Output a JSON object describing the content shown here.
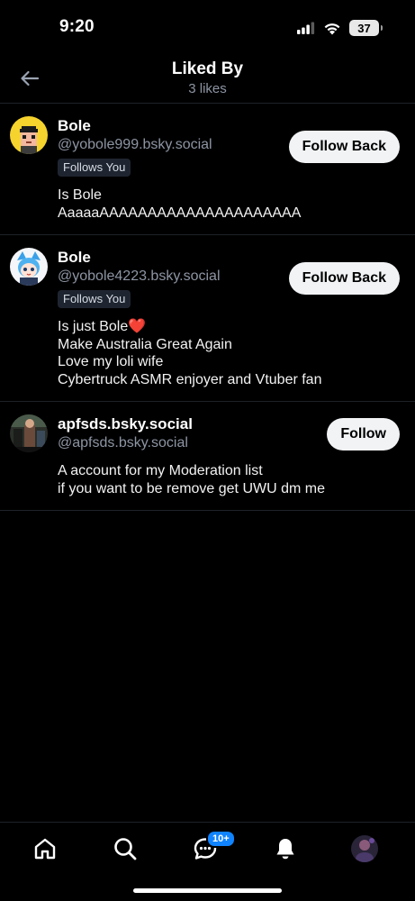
{
  "status": {
    "time": "9:20",
    "battery": "37"
  },
  "header": {
    "title": "Liked By",
    "subtitle": "3 likes"
  },
  "users": [
    {
      "name": "Bole",
      "handle": "@yobole999.bsky.social",
      "badge": "Follows You",
      "bio": "Is Bole\nAaaaaAAAAAAAAAAAAAAAAAAAAA",
      "button": "Follow Back"
    },
    {
      "name": "Bole",
      "handle": "@yobole4223.bsky.social",
      "badge": "Follows You",
      "bio": "Is just Bole❤️\nMake Australia Great Again\nLove my loli wife\nCybertruck ASMR enjoyer and Vtuber fan",
      "button": "Follow Back"
    },
    {
      "name": "apfsds.bsky.social",
      "handle": "@apfsds.bsky.social",
      "bio": "A account for my Moderation list\nif you want to be remove get UWU dm me",
      "button": "Follow"
    }
  ],
  "tabbar": {
    "items": [
      "home-icon",
      "search-icon",
      "chat-icon",
      "bell-icon",
      "profile-avatar"
    ],
    "chat_badge": "10+"
  },
  "colors": {
    "background": "#000000",
    "muted": "#8d95a3",
    "accent": "#1083fe",
    "button_bg": "#f1f3f5"
  }
}
